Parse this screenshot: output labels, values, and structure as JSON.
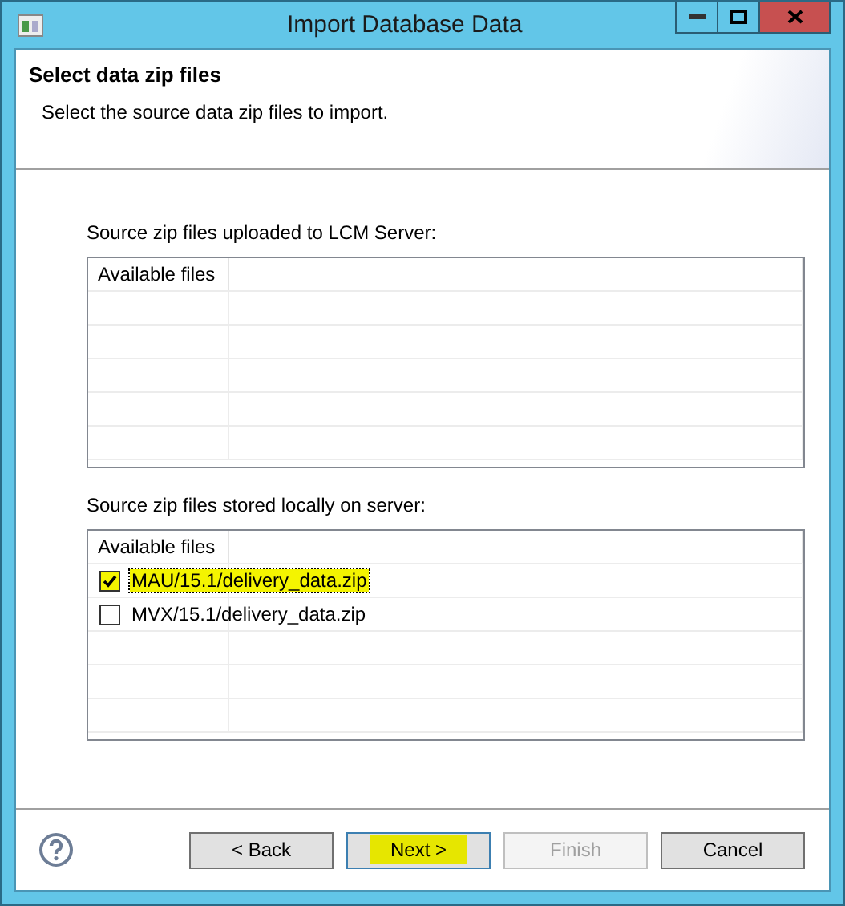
{
  "window": {
    "title": "Import Database Data"
  },
  "header": {
    "title": "Select data zip files",
    "description": "Select the source data zip files to import."
  },
  "uploaded_section": {
    "label": "Source zip files uploaded to LCM Server:",
    "columns": [
      "Available files"
    ]
  },
  "local_section": {
    "label": "Source zip files stored locally on server:",
    "columns": [
      "Available files"
    ],
    "rows": [
      {
        "name": "MAU/15.1/delivery_data.zip",
        "checked": true,
        "highlighted": true
      },
      {
        "name": "MVX/15.1/delivery_data.zip",
        "checked": false,
        "highlighted": false
      }
    ]
  },
  "buttons": [
    {
      "label": "< Back",
      "disabled": false,
      "highlighted": false
    },
    {
      "label": "Next >",
      "disabled": false,
      "highlighted": true
    },
    {
      "label": "Finish",
      "disabled": true,
      "highlighted": false
    },
    {
      "label": "Cancel",
      "disabled": false,
      "highlighted": false
    }
  ]
}
